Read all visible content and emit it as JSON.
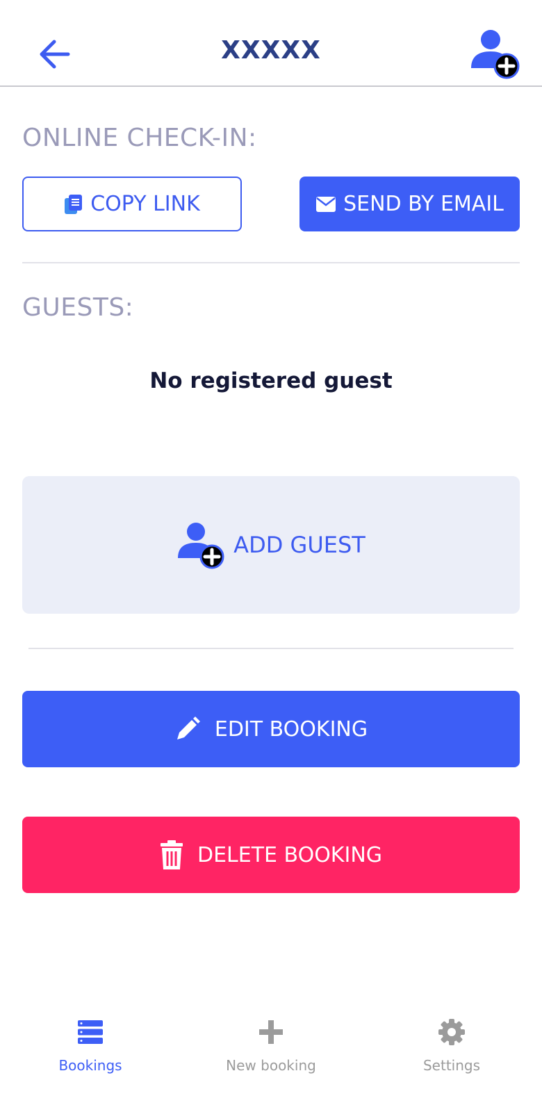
{
  "header": {
    "title": "XXXXX",
    "back_icon": "arrow-left-icon",
    "add_guest_icon": "user-plus-icon"
  },
  "checkin": {
    "label": "ONLINE CHECK-IN:",
    "copy_link": "COPY LINK",
    "send_email": "SEND BY EMAIL"
  },
  "guests": {
    "label": "GUESTS:",
    "empty_text": "No registered guest",
    "add_guest": "ADD GUEST"
  },
  "actions": {
    "edit": "EDIT BOOKING",
    "delete": "DELETE BOOKING"
  },
  "tabs": [
    {
      "label": "Bookings",
      "icon": "list-icon",
      "active": true
    },
    {
      "label": "New booking",
      "icon": "plus-icon",
      "active": false
    },
    {
      "label": "Settings",
      "icon": "gear-icon",
      "active": false
    }
  ],
  "colors": {
    "primary": "#3d5ef6",
    "danger": "#ff2464",
    "label": "#9a9ab8",
    "title": "#2b3f86",
    "card_bg": "#ebeef8",
    "tab_inactive": "#9b9b9b"
  }
}
